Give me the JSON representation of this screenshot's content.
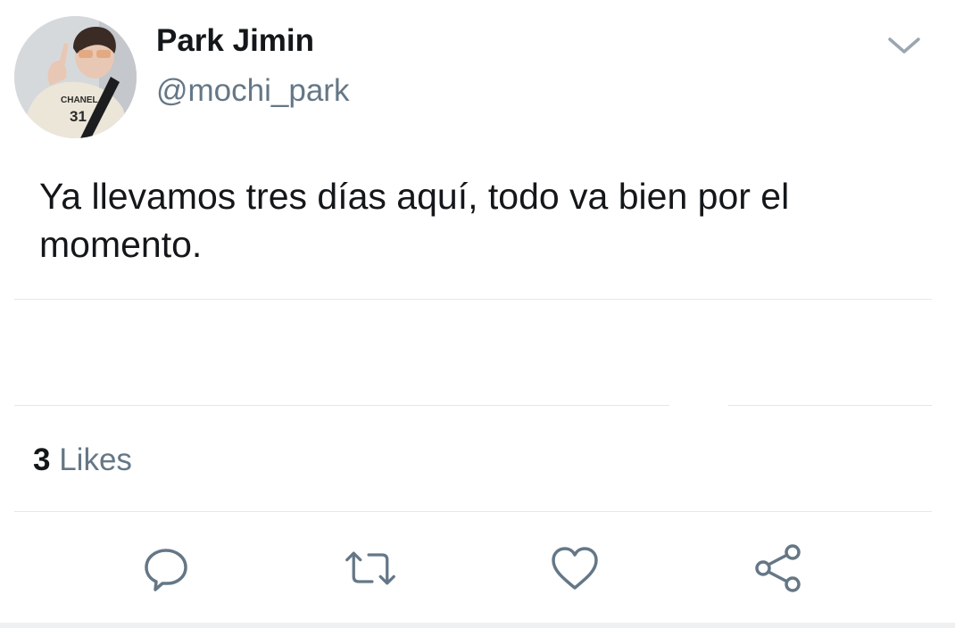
{
  "tweet": {
    "user": {
      "display_name": "Park Jimin",
      "handle": "@mochi_park"
    },
    "text": "Ya llevamos tres días aquí, todo va bien por el momento.",
    "likes": {
      "count": "3",
      "label": "Likes"
    },
    "actions": [
      {
        "icon": "reply-icon"
      },
      {
        "icon": "retweet-icon"
      },
      {
        "icon": "like-heart-icon"
      },
      {
        "icon": "share-icon"
      }
    ],
    "menu_icon": "chevron-down-icon",
    "avatar_shirt_text": {
      "brand": "CHANEL",
      "number": "31"
    }
  },
  "colors": {
    "text_primary": "#14171a",
    "text_secondary": "#657786",
    "divider": "#e1e8ed",
    "icon": "#657786"
  }
}
